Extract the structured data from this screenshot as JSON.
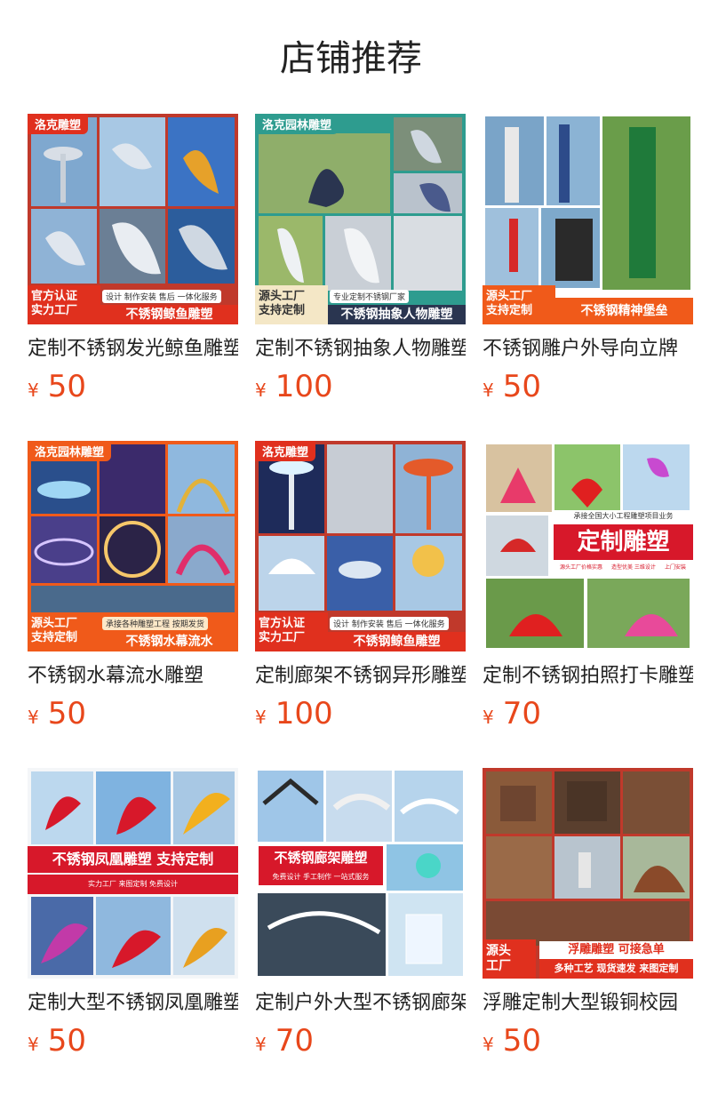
{
  "page": {
    "title": "店铺推荐"
  },
  "colors": {
    "price": "#e8471b",
    "badge_red": "#e0301e",
    "badge_orange": "#f05a1a",
    "badge_teal": "#2e9c8f"
  },
  "products": [
    {
      "title": "定制不锈钢发光鲸鱼雕塑",
      "currency": "¥",
      "price": "50",
      "image": {
        "corner": "洛克雕塑",
        "left_line1": "官方认证",
        "left_line2": "实力工厂",
        "top_text": "设计 制作安装 售后 一体化服务",
        "main_text": "不锈钢鲸鱼雕塑"
      }
    },
    {
      "title": "定制不锈钢抽象人物雕塑",
      "currency": "¥",
      "price": "100",
      "image": {
        "corner": "洛克园林雕塑",
        "left_line1": "源头工厂",
        "left_line2": "支持定制",
        "top_text": "专业定制不锈钢厂家",
        "main_text": "不锈钢抽象人物雕塑"
      }
    },
    {
      "title": "不锈钢雕户外导向立牌",
      "currency": "¥",
      "price": "50",
      "image": {
        "left_line1": "源头工厂",
        "left_line2": "支持定制",
        "main_text": "不锈钢精神堡垒"
      }
    },
    {
      "title": "不锈钢水幕流水雕塑",
      "currency": "¥",
      "price": "50",
      "image": {
        "corner": "洛克园林雕塑",
        "left_line1": "源头工厂",
        "left_line2": "支持定制",
        "top_text": "承接各种雕塑工程 按期发货",
        "main_text": "不锈钢水幕流水"
      }
    },
    {
      "title": "定制廊架不锈钢异形雕塑",
      "currency": "¥",
      "price": "100",
      "image": {
        "corner": "洛克雕塑",
        "left_line1": "官方认证",
        "left_line2": "实力工厂",
        "top_text": "设计 制作安装 售后 一体化服务",
        "main_text": "不锈钢鲸鱼雕塑"
      }
    },
    {
      "title": "定制不锈钢拍照打卡雕塑",
      "currency": "¥",
      "price": "70",
      "image": {
        "top_text": "承接全国大小工程雕塑项目业务",
        "main_text": "定制雕塑",
        "tags": [
          "源头工厂价格实惠",
          "造型优美 三维设计",
          "上门安装"
        ]
      }
    },
    {
      "title": "定制大型不锈钢凤凰雕塑",
      "currency": "¥",
      "price": "50",
      "image": {
        "main_text": "不锈钢凤凰雕塑 支持定制",
        "sub_text": "实力工厂  来图定制  免费设计"
      }
    },
    {
      "title": "定制户外大型不锈钢廊架",
      "currency": "¥",
      "price": "70",
      "image": {
        "main_text": "不锈钢廊架雕塑",
        "sub_text": "免费设计 手工制作 一站式服务"
      }
    },
    {
      "title": "浮雕定制大型锻铜校园",
      "currency": "¥",
      "price": "50",
      "image": {
        "left_line1": "源头",
        "left_line2": "工厂",
        "top_text": "浮雕雕塑 可接急单",
        "main_text": "多种工艺 现货速发 来图定制"
      }
    }
  ]
}
